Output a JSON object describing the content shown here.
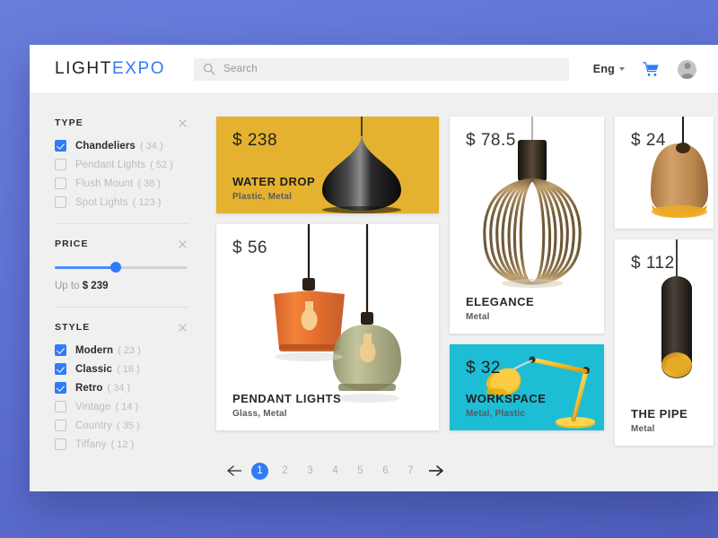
{
  "header": {
    "logo_first": "LIGHT",
    "logo_second": "EXPO",
    "search_placeholder": "Search",
    "search_value": "",
    "language": "Eng",
    "search_icon": "search-icon",
    "cart_icon": "shopping-cart-icon",
    "avatar_icon": "user-avatar-icon"
  },
  "sidebar": {
    "sections": [
      {
        "title": "TYPE",
        "close_icon": "close-icon",
        "options": [
          {
            "label": "Chandeliers",
            "count": "( 34 )",
            "checked": true
          },
          {
            "label": "Pendant Lights",
            "count": "( 52 )",
            "checked": false
          },
          {
            "label": "Flush Mount",
            "count": "( 38 )",
            "checked": false
          },
          {
            "label": "Spot Lights",
            "count": "( 123 )",
            "checked": false
          }
        ]
      },
      {
        "title": "PRICE",
        "close_icon": "close-icon",
        "slider_percent": 46,
        "price_prefix": "Up to",
        "price_value": "$ 239"
      },
      {
        "title": "STYLE",
        "close_icon": "close-icon",
        "options": [
          {
            "label": "Modern",
            "count": "( 23 )",
            "checked": true
          },
          {
            "label": "Classic",
            "count": "( 18 )",
            "checked": true
          },
          {
            "label": "Retro",
            "count": "( 34 )",
            "checked": true
          },
          {
            "label": "Vintage",
            "count": "( 14 )",
            "checked": false
          },
          {
            "label": "Country",
            "count": "( 35 )",
            "checked": false
          },
          {
            "label": "Tiffany",
            "count": "( 12 )",
            "checked": false
          }
        ]
      }
    ]
  },
  "products": {
    "water_drop": {
      "price": "$ 238",
      "name": "WATER DROP",
      "materials": "Plastic, Metal",
      "bg": "#e5b22f"
    },
    "pendant": {
      "price": "$ 56",
      "name": "PENDANT LIGHTS",
      "materials": "Glass, Metal",
      "bg": "#ffffff"
    },
    "elegance": {
      "price": "$ 78.5",
      "name": "ELEGANCE",
      "materials": "Metal",
      "bg": "#ffffff"
    },
    "workspace": {
      "price": "$ 32",
      "name": "WORKSPACE",
      "materials": "Metal, Plastic",
      "bg": "#1dbdd6"
    },
    "wood": {
      "price": "$ 24",
      "name": "",
      "materials": "",
      "bg": "#ffffff"
    },
    "pipe": {
      "price": "$ 112",
      "name": "THE PIPE",
      "materials": "Metal",
      "bg": "#ffffff"
    }
  },
  "pagination": {
    "prev_icon": "arrow-left-icon",
    "next_icon": "arrow-right-icon",
    "pages": [
      "1",
      "2",
      "3",
      "4",
      "5",
      "6",
      "7"
    ],
    "active_page": "1"
  },
  "colors": {
    "accent_blue": "#2f7cf6",
    "page_background": "#6274d6",
    "panel_background": "#f0f0f0",
    "yellow_card": "#e5b22f",
    "cyan_card": "#1dbdd6"
  }
}
